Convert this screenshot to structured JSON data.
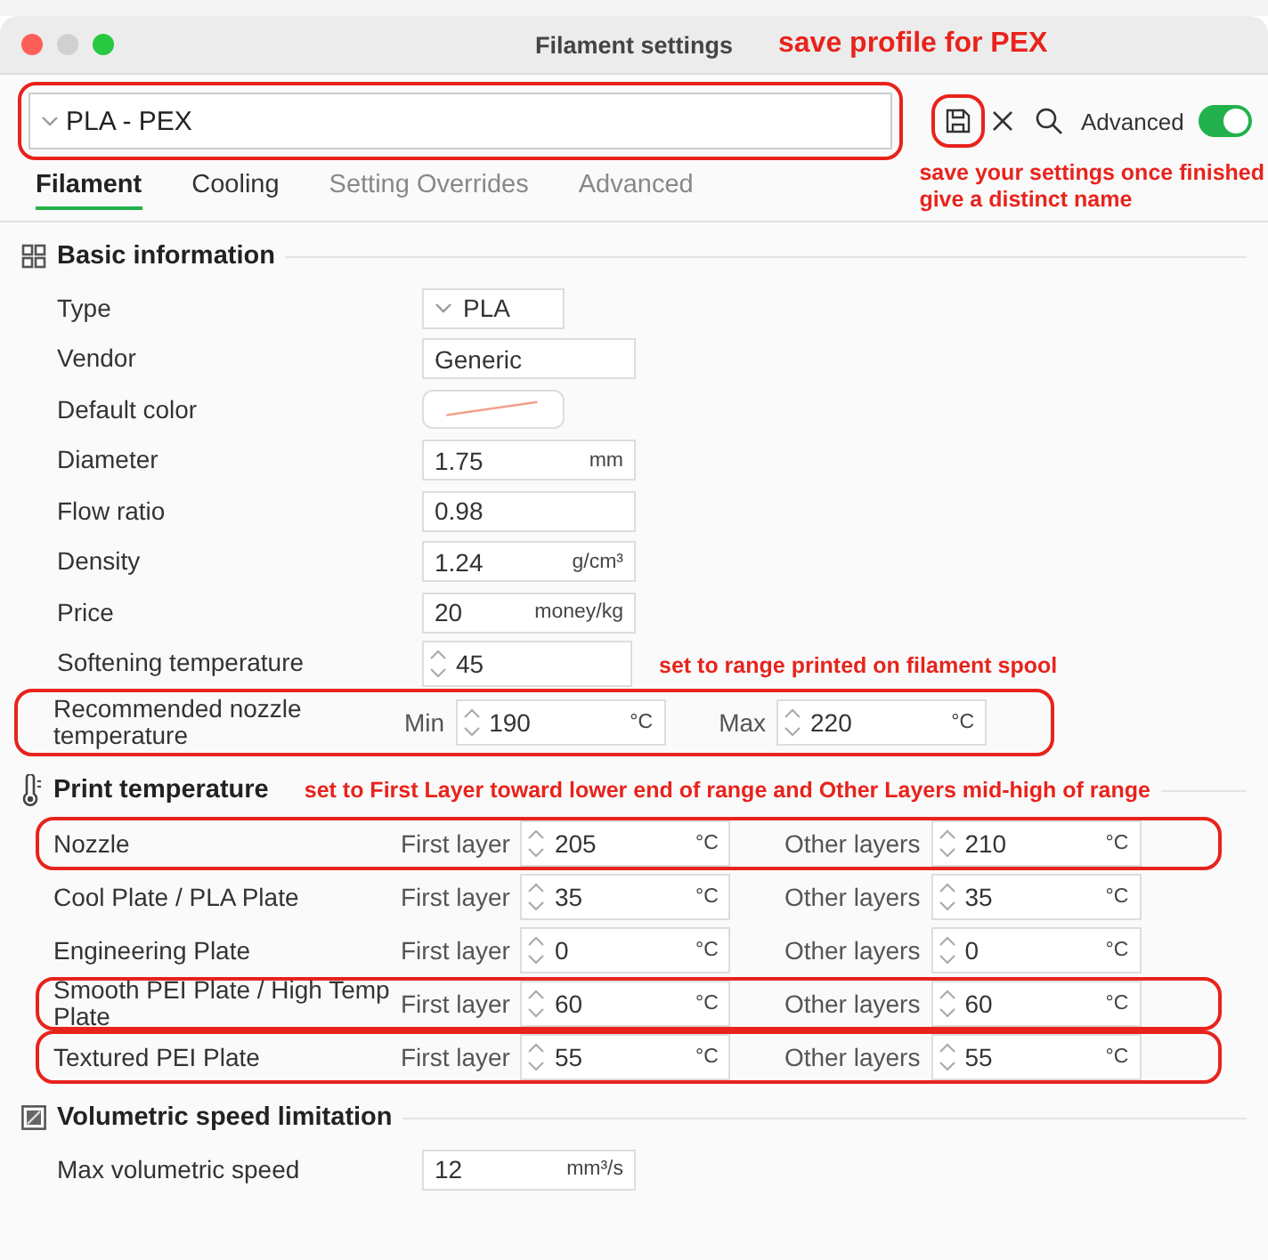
{
  "window": {
    "title": "Filament settings",
    "note": "save profile for PEX"
  },
  "toolbar": {
    "preset": "PLA - PEX",
    "preset_highlighted": true,
    "save_highlighted": true,
    "advanced_label": "Advanced",
    "advanced_on": true,
    "note_lines": [
      "save your settings once finished",
      "give a distinct name"
    ]
  },
  "tabs": [
    {
      "label": "Filament",
      "selected": true,
      "disabled": false
    },
    {
      "label": "Cooling",
      "selected": false,
      "disabled": false
    },
    {
      "label": "Setting Overrides",
      "selected": false,
      "disabled": true
    },
    {
      "label": "Advanced",
      "selected": false,
      "disabled": true
    }
  ],
  "sections": [
    {
      "title": "Basic information",
      "rows": [
        {
          "kind": "dropdown",
          "label": "Type",
          "value": "PLA"
        },
        {
          "kind": "text",
          "label": "Vendor",
          "value": "Generic"
        },
        {
          "kind": "color",
          "label": "Default color"
        },
        {
          "kind": "number",
          "label": "Diameter",
          "value": "1.75",
          "unit": "mm"
        },
        {
          "kind": "number",
          "label": "Flow ratio",
          "value": "0.98"
        },
        {
          "kind": "number",
          "label": "Density",
          "value": "1.24",
          "unit": "g/cm³"
        },
        {
          "kind": "number",
          "label": "Price",
          "value": "20",
          "unit": "money/kg"
        },
        {
          "kind": "spin",
          "label": "Softening temperature",
          "value": "45"
        },
        {
          "kind": "range",
          "label": "Recommended nozzle temperature",
          "highlighted": true,
          "note": "set to range printed on filament spool",
          "fields": [
            {
              "label": "Min",
              "value": "190",
              "unit": "°C"
            },
            {
              "label": "Max",
              "value": "220",
              "unit": "°C"
            }
          ]
        }
      ]
    },
    {
      "title": "Print temperature",
      "note": "set to First Layer toward lower end of range and Other Layers mid-high of range",
      "rows": [
        {
          "kind": "range",
          "label": "Nozzle",
          "highlighted": true,
          "fields": [
            {
              "label": "First layer",
              "value": "205",
              "unit": "°C"
            },
            {
              "label": "Other layers",
              "value": "210",
              "unit": "°C"
            }
          ]
        },
        {
          "kind": "range",
          "label": "Cool Plate / PLA Plate",
          "highlighted": false,
          "fields": [
            {
              "label": "First layer",
              "value": "35",
              "unit": "°C"
            },
            {
              "label": "Other layers",
              "value": "35",
              "unit": "°C"
            }
          ]
        },
        {
          "kind": "range",
          "label": "Engineering Plate",
          "highlighted": false,
          "fields": [
            {
              "label": "First layer",
              "value": "0",
              "unit": "°C"
            },
            {
              "label": "Other layers",
              "value": "0",
              "unit": "°C"
            }
          ]
        },
        {
          "kind": "range",
          "label": "Smooth PEI Plate / High Temp Plate",
          "highlighted": true,
          "fields": [
            {
              "label": "First layer",
              "value": "60",
              "unit": "°C"
            },
            {
              "label": "Other layers",
              "value": "60",
              "unit": "°C"
            }
          ]
        },
        {
          "kind": "range",
          "label": "Textured PEI Plate",
          "highlighted": true,
          "fields": [
            {
              "label": "First layer",
              "value": "55",
              "unit": "°C"
            },
            {
              "label": "Other layers",
              "value": "55",
              "unit": "°C"
            }
          ]
        }
      ]
    },
    {
      "title": "Volumetric speed limitation",
      "rows": [
        {
          "kind": "number",
          "label": "Max volumetric speed",
          "value": "12",
          "unit": "mm³/s"
        }
      ]
    }
  ]
}
